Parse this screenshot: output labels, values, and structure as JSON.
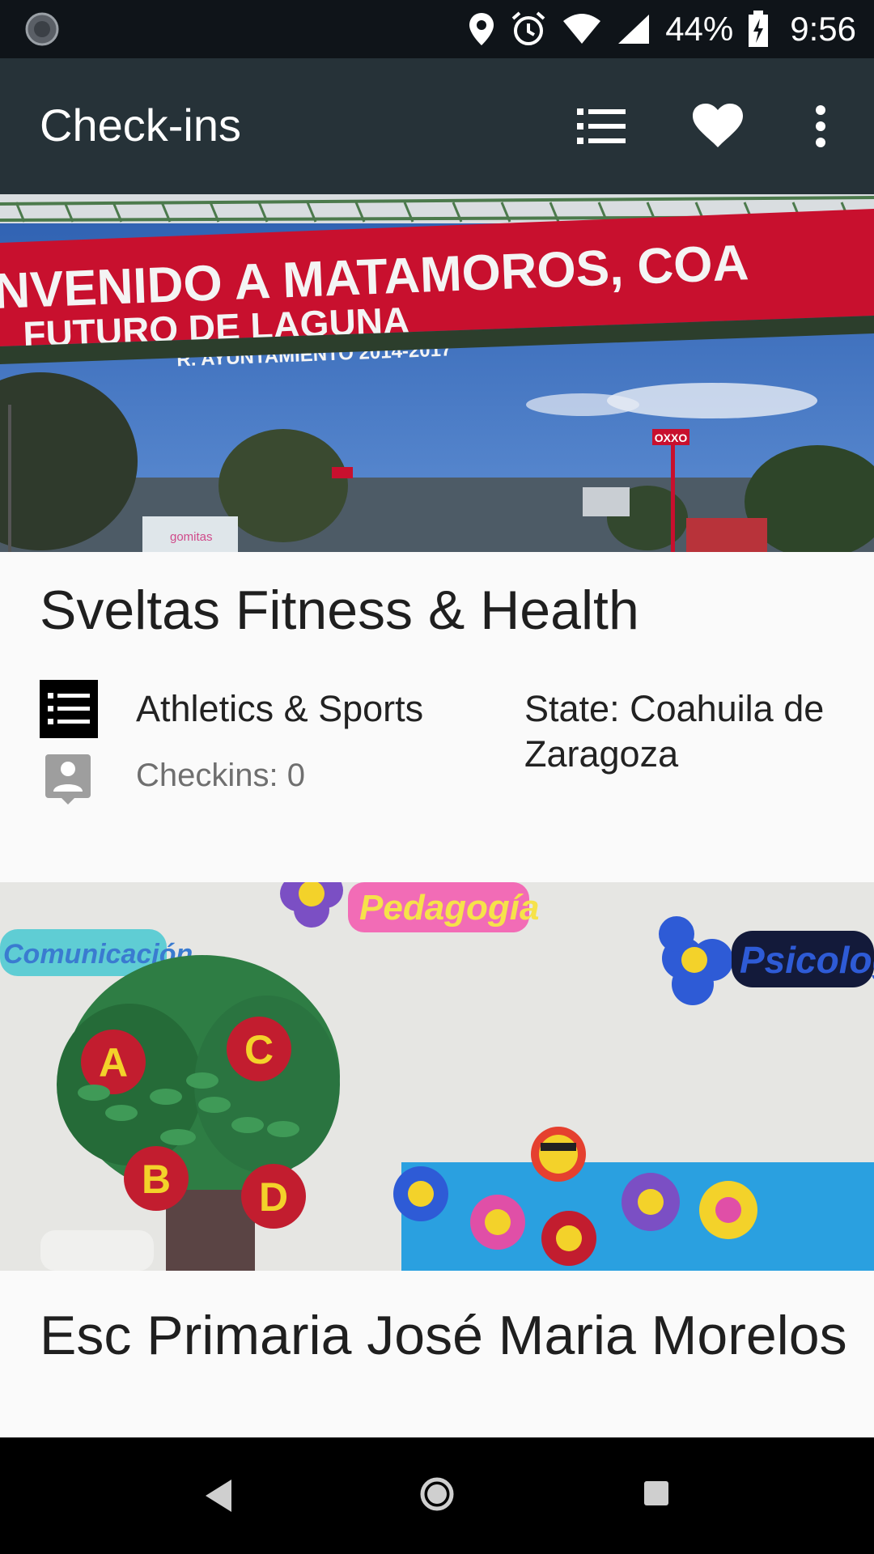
{
  "status_bar": {
    "battery": "44%",
    "time": "9:56",
    "icons": [
      "loading-icon",
      "location-icon",
      "alarm-icon",
      "wifi-icon",
      "signal-icon",
      "battery-charging-icon"
    ]
  },
  "app_bar": {
    "title": "Check-ins",
    "actions": [
      "list-icon",
      "heart-icon",
      "more-vert-icon"
    ]
  },
  "cards": [
    {
      "name": "Sveltas Fitness & Health",
      "category": "Athletics & Sports",
      "state": "State: Coahuila de Zaragoza",
      "checkins": "Checkins: 0",
      "banner_text": [
        "NVENIDO A MATAMOROS, COA",
        "FUTURO DE LAGUNA",
        "R. AYUNTAMIENTO 2014-2017"
      ],
      "store_sign": "OXXO",
      "truck_text": "gomitas"
    },
    {
      "name": "Esc Primaria José Maria Morelos",
      "wall_labels": [
        "Pedagogía",
        "Comunicación",
        "Psicología"
      ],
      "tree_letters": [
        "A",
        "C",
        "B",
        "D"
      ]
    }
  ],
  "colors": {
    "status_bar": "#0f1419",
    "app_bar": "#263238",
    "card_background": "#fafafa",
    "nav_bar": "#000000"
  }
}
